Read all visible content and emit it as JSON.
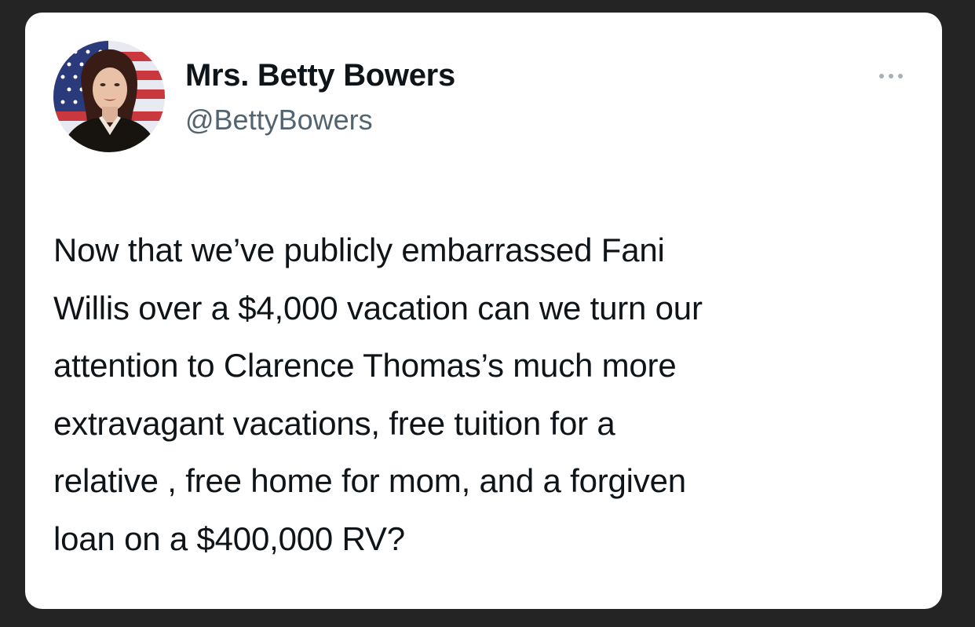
{
  "tweet": {
    "author": {
      "display_name": "Mrs. Betty Bowers",
      "handle": "@BettyBowers",
      "avatar_icon": "profile-photo"
    },
    "more_icon": "more-options-icon",
    "text": "Now that we’ve publicly embarrassed Fani\nWillis over a $4,000 vacation can we turn our\nattention to Clarence Thomas’s much more\nextravagant vacations, free tuition for a\nrelative , free home for mom, and a forgiven\nloan on a $400,000 RV?"
  },
  "colors": {
    "background": "#242424",
    "card": "#ffffff",
    "text_primary": "#0f1419",
    "text_secondary": "#536471"
  }
}
